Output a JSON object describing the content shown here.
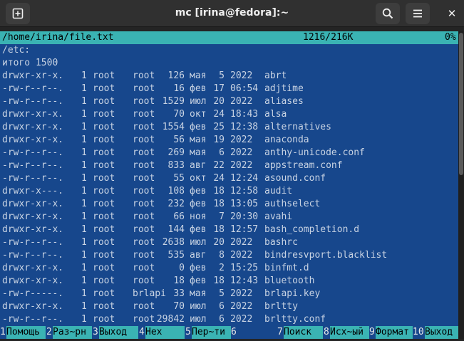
{
  "window": {
    "title": "mc [irina@fedora]:~",
    "buttons": {
      "new_tab_icon": "new-tab-icon",
      "search_icon": "search-icon",
      "menu_icon": "hamburger-menu-icon",
      "close": "✕"
    }
  },
  "viewer": {
    "file_path": "/home/irina/file.txt",
    "position": "1216/216K",
    "percent": "0%",
    "lines": [
      "/etc:",
      "итого 1500"
    ],
    "rows": [
      {
        "perms": "drwxr-xr-x.",
        "links": "1",
        "owner": "root",
        "group": "root",
        "size": "126",
        "month": "мая",
        "day": "5",
        "time": "2022",
        "name": "abrt"
      },
      {
        "perms": "-rw-r--r--.",
        "links": "1",
        "owner": "root",
        "group": "root",
        "size": "16",
        "month": "фев",
        "day": "17",
        "time": "06:54",
        "name": "adjtime"
      },
      {
        "perms": "-rw-r--r--.",
        "links": "1",
        "owner": "root",
        "group": "root",
        "size": "1529",
        "month": "июл",
        "day": "20",
        "time": "2022",
        "name": "aliases"
      },
      {
        "perms": "drwxr-xr-x.",
        "links": "1",
        "owner": "root",
        "group": "root",
        "size": "70",
        "month": "окт",
        "day": "24",
        "time": "18:43",
        "name": "alsa"
      },
      {
        "perms": "drwxr-xr-x.",
        "links": "1",
        "owner": "root",
        "group": "root",
        "size": "1554",
        "month": "фев",
        "day": "25",
        "time": "12:38",
        "name": "alternatives"
      },
      {
        "perms": "drwxr-xr-x.",
        "links": "1",
        "owner": "root",
        "group": "root",
        "size": "56",
        "month": "мая",
        "day": "19",
        "time": "2022",
        "name": "anaconda"
      },
      {
        "perms": "-rw-r--r--.",
        "links": "1",
        "owner": "root",
        "group": "root",
        "size": "269",
        "month": "мая",
        "day": "6",
        "time": "2022",
        "name": "anthy-unicode.conf"
      },
      {
        "perms": "-rw-r--r--.",
        "links": "1",
        "owner": "root",
        "group": "root",
        "size": "833",
        "month": "авг",
        "day": "22",
        "time": "2022",
        "name": "appstream.conf"
      },
      {
        "perms": "-rw-r--r--.",
        "links": "1",
        "owner": "root",
        "group": "root",
        "size": "55",
        "month": "окт",
        "day": "24",
        "time": "12:24",
        "name": "asound.conf"
      },
      {
        "perms": "drwxr-x---.",
        "links": "1",
        "owner": "root",
        "group": "root",
        "size": "108",
        "month": "фев",
        "day": "18",
        "time": "12:58",
        "name": "audit"
      },
      {
        "perms": "drwxr-xr-x.",
        "links": "1",
        "owner": "root",
        "group": "root",
        "size": "232",
        "month": "фев",
        "day": "18",
        "time": "13:05",
        "name": "authselect"
      },
      {
        "perms": "drwxr-xr-x.",
        "links": "1",
        "owner": "root",
        "group": "root",
        "size": "66",
        "month": "ноя",
        "day": "7",
        "time": "20:30",
        "name": "avahi"
      },
      {
        "perms": "drwxr-xr-x.",
        "links": "1",
        "owner": "root",
        "group": "root",
        "size": "144",
        "month": "фев",
        "day": "18",
        "time": "12:57",
        "name": "bash_completion.d"
      },
      {
        "perms": "-rw-r--r--.",
        "links": "1",
        "owner": "root",
        "group": "root",
        "size": "2638",
        "month": "июл",
        "day": "20",
        "time": "2022",
        "name": "bashrc"
      },
      {
        "perms": "-rw-r--r--.",
        "links": "1",
        "owner": "root",
        "group": "root",
        "size": "535",
        "month": "авг",
        "day": "8",
        "time": "2022",
        "name": "bindresvport.blacklist"
      },
      {
        "perms": "drwxr-xr-x.",
        "links": "1",
        "owner": "root",
        "group": "root",
        "size": "0",
        "month": "фев",
        "day": "2",
        "time": "15:25",
        "name": "binfmt.d"
      },
      {
        "perms": "drwxr-xr-x.",
        "links": "1",
        "owner": "root",
        "group": "root",
        "size": "18",
        "month": "фев",
        "day": "18",
        "time": "12:43",
        "name": "bluetooth"
      },
      {
        "perms": "-rw-r-----.",
        "links": "1",
        "owner": "root",
        "group": "brlapi",
        "size": "33",
        "month": "мая",
        "day": "5",
        "time": "2022",
        "name": "brlapi.key"
      },
      {
        "perms": "drwxr-xr-x.",
        "links": "1",
        "owner": "root",
        "group": "root",
        "size": "70",
        "month": "июл",
        "day": "6",
        "time": "2022",
        "name": "brltty"
      },
      {
        "perms": "-rw-r--r--.",
        "links": "1",
        "owner": "root",
        "group": "root",
        "size": "29842",
        "month": "июл",
        "day": "6",
        "time": "2022",
        "name": "brltty.conf"
      }
    ]
  },
  "fkeys": [
    {
      "num": "1",
      "label": "Помощь"
    },
    {
      "num": "2",
      "label": "Раз~рн"
    },
    {
      "num": "3",
      "label": "Выход"
    },
    {
      "num": "4",
      "label": "Hex"
    },
    {
      "num": "5",
      "label": "Пер~ти"
    },
    {
      "num": "6",
      "label": ""
    },
    {
      "num": "7",
      "label": "Поиск"
    },
    {
      "num": "8",
      "label": "Исх~ый"
    },
    {
      "num": "9",
      "label": "Формат"
    },
    {
      "num": "10",
      "label": "Выход"
    }
  ],
  "colors": {
    "terminal_bg": "#17478c",
    "status_bg": "#3ab3b3",
    "text": "#c8d3e3",
    "titlebar": "#303030"
  }
}
